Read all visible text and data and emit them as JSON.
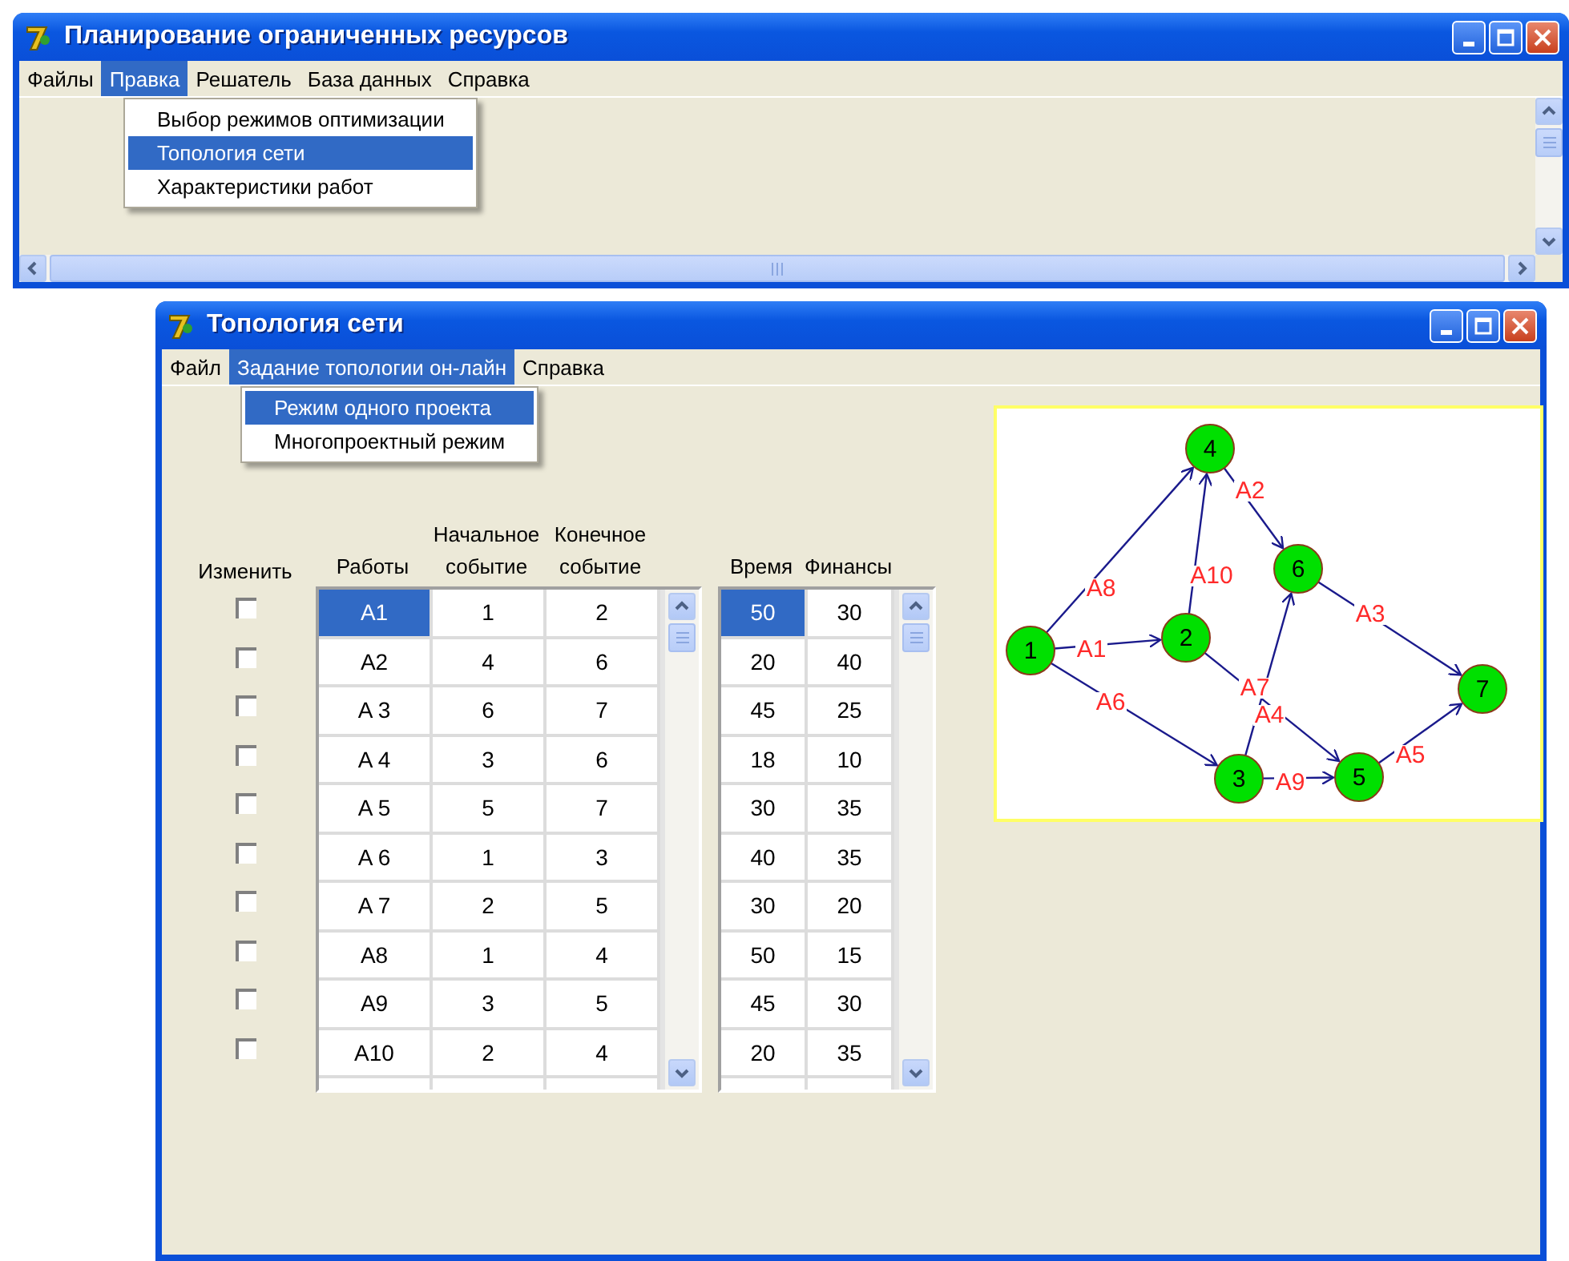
{
  "main_window": {
    "title": "Планирование ограниченных ресурсов",
    "menu": [
      {
        "label": "Файлы",
        "selected": false
      },
      {
        "label": "Правка",
        "selected": true
      },
      {
        "label": "Решатель",
        "selected": false
      },
      {
        "label": "База данных",
        "selected": false
      },
      {
        "label": "Справка",
        "selected": false
      }
    ],
    "dropdown": [
      {
        "label": "Выбор режимов оптимизации",
        "selected": false
      },
      {
        "label": "Топология сети",
        "selected": true
      },
      {
        "label": "Характеристики работ",
        "selected": false
      }
    ]
  },
  "topology_window": {
    "title": "Топология сети",
    "menu": [
      {
        "label": "Файл",
        "selected": false
      },
      {
        "label": "Задание топологии он-лайн",
        "selected": true
      },
      {
        "label": "Справка",
        "selected": false
      }
    ],
    "dropdown": [
      {
        "label": "Режим одного проекта",
        "selected": true
      },
      {
        "label": "Многопроектный режим",
        "selected": false
      }
    ],
    "change_header": "Изменить",
    "checkboxes": [
      {
        "checked": false
      },
      {
        "checked": false
      },
      {
        "checked": false
      },
      {
        "checked": false
      },
      {
        "checked": false
      },
      {
        "checked": false
      },
      {
        "checked": false
      },
      {
        "checked": false
      },
      {
        "checked": false
      },
      {
        "checked": false
      }
    ],
    "works_table": {
      "columns": [
        "Работы",
        "Начальное событие",
        "Конечное событие"
      ],
      "rows": [
        {
          "cells": [
            "A1",
            "1",
            "2"
          ],
          "selected": true
        },
        {
          "cells": [
            "A2",
            "4",
            "6"
          ],
          "selected": false
        },
        {
          "cells": [
            "A 3",
            "6",
            "7"
          ],
          "selected": false
        },
        {
          "cells": [
            "A 4",
            "3",
            "6"
          ],
          "selected": false
        },
        {
          "cells": [
            "A 5",
            "5",
            "7"
          ],
          "selected": false
        },
        {
          "cells": [
            "A 6",
            "1",
            "3"
          ],
          "selected": false
        },
        {
          "cells": [
            "A 7",
            "2",
            "5"
          ],
          "selected": false
        },
        {
          "cells": [
            "A8",
            "1",
            "4"
          ],
          "selected": false
        },
        {
          "cells": [
            "A9",
            "3",
            "5"
          ],
          "selected": false
        },
        {
          "cells": [
            "A10",
            "2",
            "4"
          ],
          "selected": false
        }
      ]
    },
    "resources_table": {
      "columns": [
        "Время",
        "Финансы"
      ],
      "rows": [
        {
          "cells": [
            "50",
            "30"
          ],
          "selected": true
        },
        {
          "cells": [
            "20",
            "40"
          ],
          "selected": false
        },
        {
          "cells": [
            "45",
            "25"
          ],
          "selected": false
        },
        {
          "cells": [
            "18",
            "10"
          ],
          "selected": false
        },
        {
          "cells": [
            "30",
            "35"
          ],
          "selected": false
        },
        {
          "cells": [
            "40",
            "35"
          ],
          "selected": false
        },
        {
          "cells": [
            "30",
            "20"
          ],
          "selected": false
        },
        {
          "cells": [
            "50",
            "15"
          ],
          "selected": false
        },
        {
          "cells": [
            "45",
            "30"
          ],
          "selected": false
        },
        {
          "cells": [
            "20",
            "35"
          ],
          "selected": false
        }
      ]
    },
    "network": {
      "nodes": [
        {
          "label": "1"
        },
        {
          "label": "2"
        },
        {
          "label": "3"
        },
        {
          "label": "4"
        },
        {
          "label": "5"
        },
        {
          "label": "6"
        },
        {
          "label": "7"
        }
      ],
      "edges": [
        {
          "label": "A1"
        },
        {
          "label": "A2"
        },
        {
          "label": "A3"
        },
        {
          "label": "A4"
        },
        {
          "label": "A5"
        },
        {
          "label": "A6"
        },
        {
          "label": "A7"
        },
        {
          "label": "A8"
        },
        {
          "label": "A9"
        },
        {
          "label": "A10"
        }
      ]
    }
  }
}
